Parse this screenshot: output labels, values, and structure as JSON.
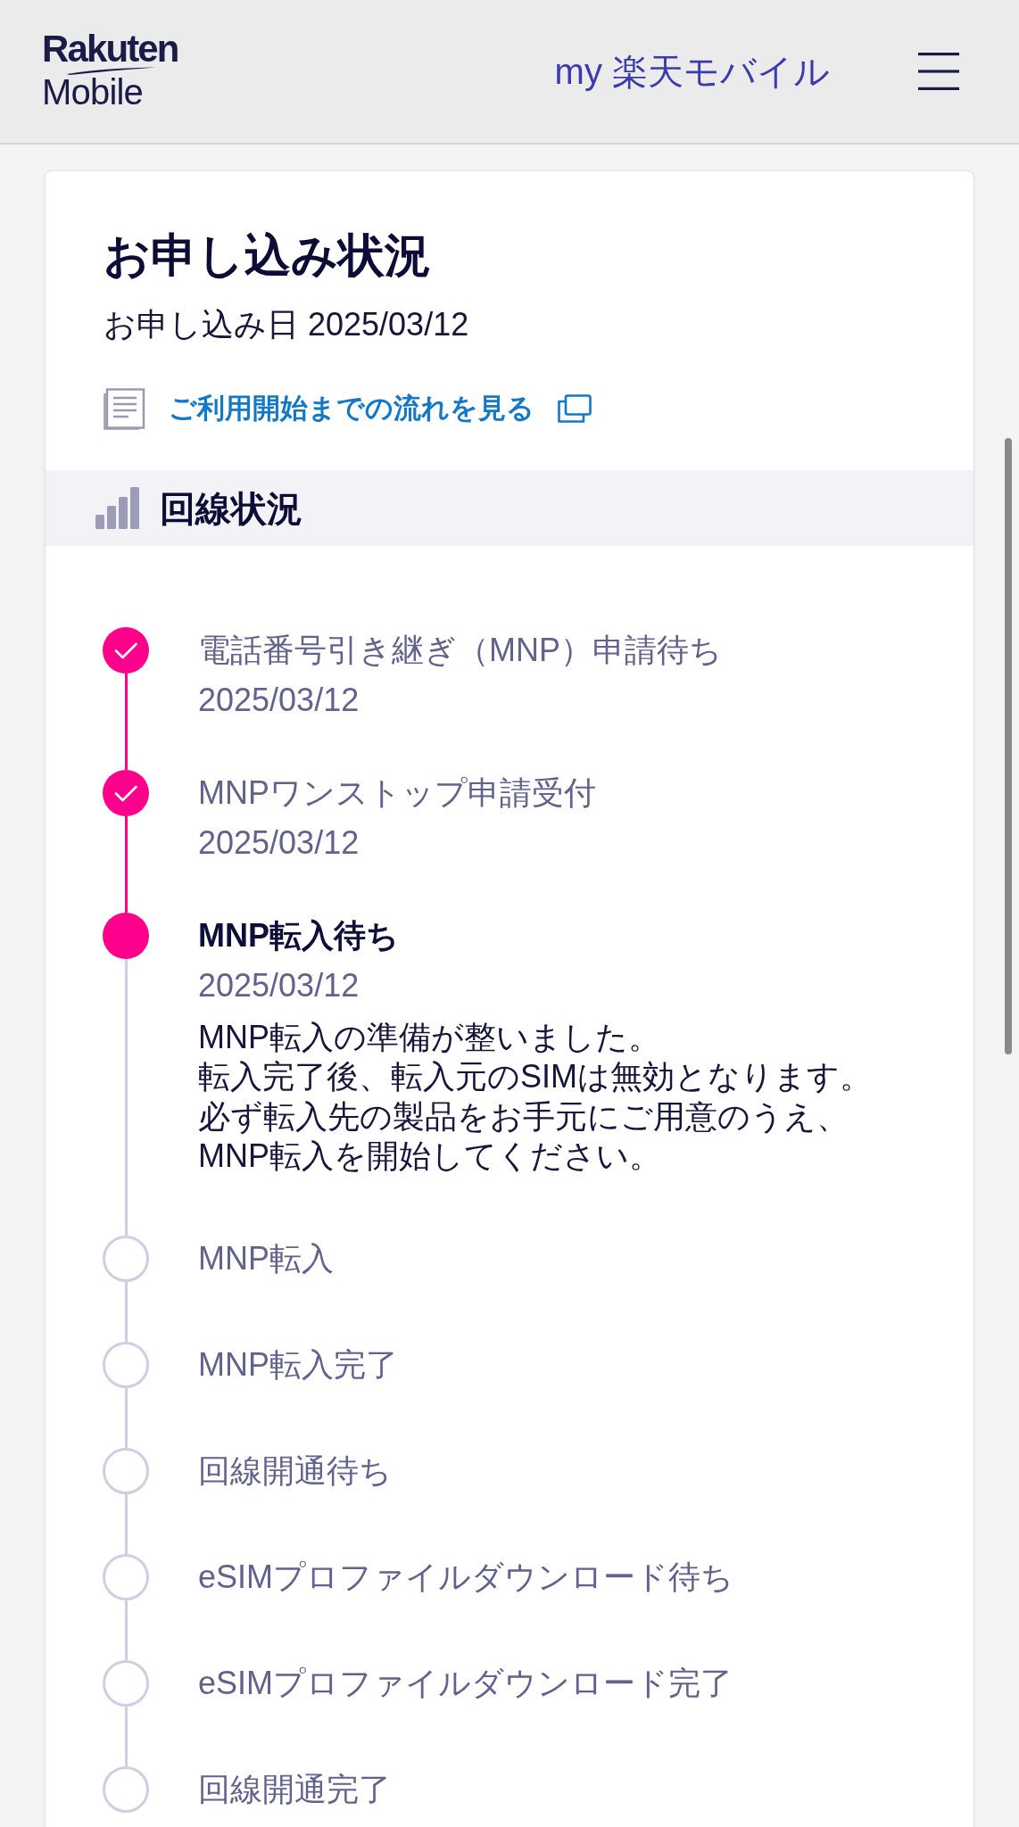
{
  "header": {
    "logo": {
      "line1": "Rakuten",
      "line2": "Mobile"
    },
    "title_link": "my 楽天モバイル"
  },
  "card": {
    "title": "お申し込み状況",
    "applied_date": "お申し込み日 2025/03/12",
    "flow_link": "ご利用開始までの流れを見る"
  },
  "section": {
    "title": "回線状況"
  },
  "steps": [
    {
      "label": "電話番号引き継ぎ（MNP）申請待ち",
      "date": "2025/03/12",
      "kind": "done"
    },
    {
      "label": "MNPワンストップ申請受付",
      "date": "2025/03/12",
      "kind": "done"
    },
    {
      "label": "MNP転入待ち",
      "date": "2025/03/12",
      "kind": "current",
      "description_lines": [
        "MNP転入の準備が整いました。",
        "転入完了後、転入元のSIMは無効となります。",
        "必ず転入先の製品をお手元にご用意のうえ、",
        "MNP転入を開始してください。"
      ]
    },
    {
      "label": "MNP転入",
      "kind": "pending"
    },
    {
      "label": "MNP転入完了",
      "kind": "pending"
    },
    {
      "label": "回線開通待ち",
      "kind": "pending"
    },
    {
      "label": "eSIMプロファイルダウンロード待ち",
      "kind": "pending"
    },
    {
      "label": "eSIMプロファイルダウンロード完了",
      "kind": "pending"
    },
    {
      "label": "回線開通完了",
      "kind": "pending"
    }
  ]
}
